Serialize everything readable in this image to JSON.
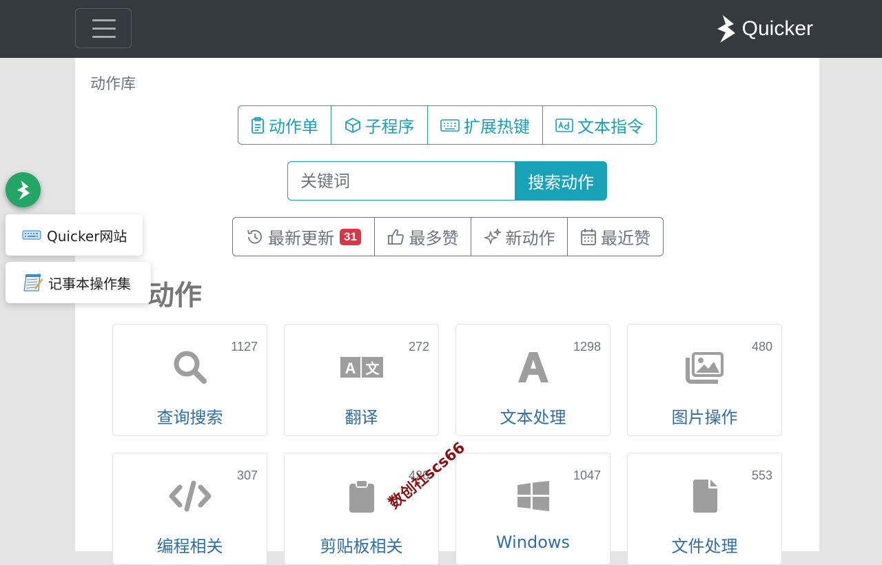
{
  "header": {
    "brand": "Quicker"
  },
  "breadcrumb": "动作库",
  "nav_group": [
    {
      "label": "动作单",
      "icon": "clipboard-list-icon"
    },
    {
      "label": "子程序",
      "icon": "cube-icon"
    },
    {
      "label": "扩展热键",
      "icon": "keyboard-icon"
    },
    {
      "label": "文本指令",
      "icon": "ad-icon"
    }
  ],
  "search": {
    "placeholder": "关键词",
    "button_label": "搜索动作"
  },
  "sort_group": [
    {
      "label": "最新更新",
      "icon": "history-icon",
      "badge": "31"
    },
    {
      "label": "最多赞",
      "icon": "thumbs-up-icon"
    },
    {
      "label": "新动作",
      "icon": "sparkles-icon"
    },
    {
      "label": "最近赞",
      "icon": "calendar-icon"
    }
  ],
  "section_title": "动作",
  "categories": [
    {
      "label": "查询搜索",
      "count": "1127",
      "icon": "search-icon"
    },
    {
      "label": "翻译",
      "count": "272",
      "icon": "translate-icon"
    },
    {
      "label": "文本处理",
      "count": "1298",
      "icon": "font-icon"
    },
    {
      "label": "图片操作",
      "count": "480",
      "icon": "images-icon"
    },
    {
      "label": "编程相关",
      "count": "307",
      "icon": "code-icon"
    },
    {
      "label": "剪贴板相关",
      "count": "426",
      "icon": "clipboard-icon"
    },
    {
      "label": "Windows",
      "count": "1047",
      "icon": "windows-icon"
    },
    {
      "label": "文件处理",
      "count": "553",
      "icon": "file-icon"
    }
  ],
  "floating_menu": [
    {
      "label": "Quicker网站",
      "icon": "keyboard-icon"
    },
    {
      "label": "记事本操作集",
      "icon": "notepad-icon"
    }
  ],
  "watermark": "数创社scs66",
  "colors": {
    "header_bg": "#343a40",
    "info": "#17a2b8",
    "link": "#2f6ea5",
    "fab": "#22a565",
    "badge": "#dc3545"
  }
}
